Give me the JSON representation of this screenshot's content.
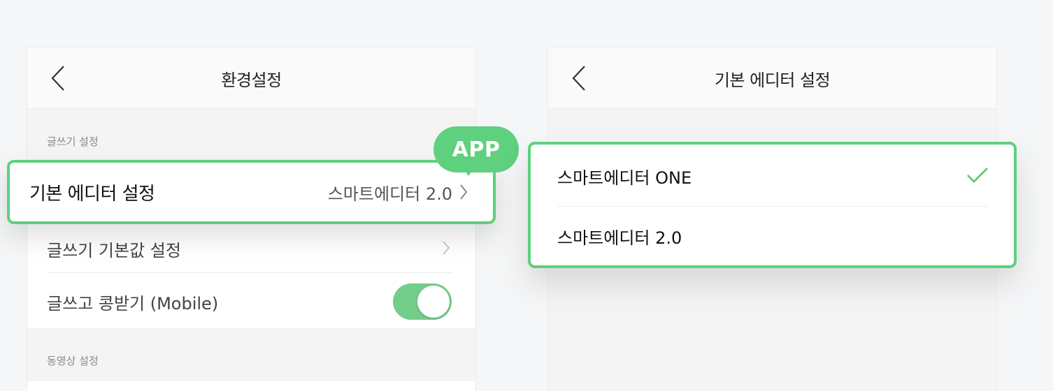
{
  "left_screen": {
    "title": "환경설정",
    "section_writing": "글쓰기 설정",
    "default_editor_row": {
      "label": "기본 에디터 설정",
      "value": "스마트에디터 2.0"
    },
    "writing_defaults_row": {
      "label": "글쓰기 기본값 설정"
    },
    "write_and_receive_row": {
      "label": "글쓰고 콩받기 (Mobile)",
      "toggle_on": true
    },
    "section_video": "동영상 설정",
    "badge": "APP"
  },
  "right_screen": {
    "title": "기본 에디터 설정",
    "options": [
      {
        "label": "스마트에디터 ONE",
        "selected": true
      },
      {
        "label": "스마트에디터 2.0",
        "selected": false
      }
    ]
  },
  "colors": {
    "accent": "#5fd07e",
    "toggle": "#74cd8a",
    "check": "#5cc473"
  },
  "icons": [
    "back-chevron-icon",
    "chevron-right-icon",
    "check-icon"
  ]
}
